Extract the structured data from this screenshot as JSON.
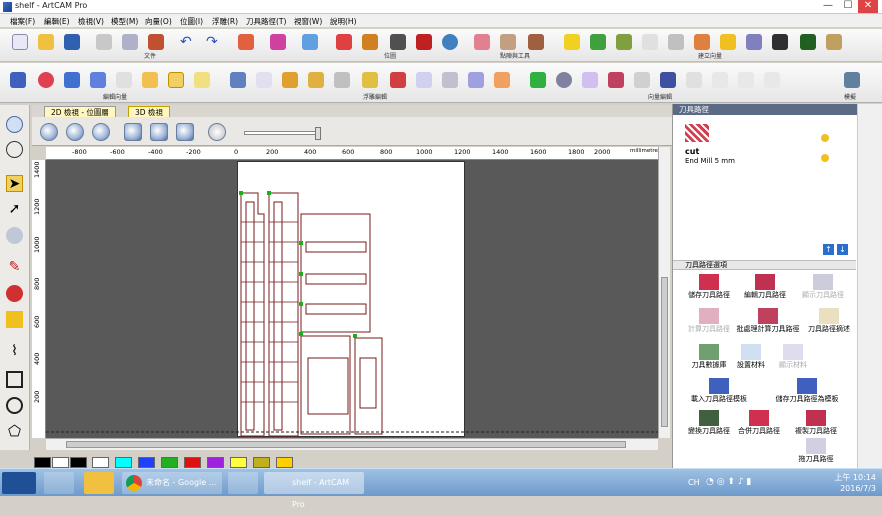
{
  "window": {
    "title": "shelf - ArtCAM Pro",
    "minimize": "—",
    "maximize": "☐",
    "close": "✕"
  },
  "menu": [
    "檔案(F)",
    "編輯(E)",
    "檢視(V)",
    "模型(M)",
    "向量(O)",
    "位圖(I)",
    "浮雕(R)",
    "刀具路徑(T)",
    "視窗(W)",
    "說明(H)"
  ],
  "toolbar_groups": {
    "file": "文件",
    "bitmap": "位圖",
    "relief_clipart": "點陣與工具",
    "vector_create": "建立向量",
    "vector_editing": "編輯向量",
    "relief_group": "浮雕編輯",
    "relief_layer": "浮雕",
    "vector_group": "向量編輯",
    "other": "模擬"
  },
  "view_tabs": [
    {
      "label": "2D 檢視 - 位圖層",
      "active": true
    },
    {
      "label": "3D 檢視",
      "active": false
    }
  ],
  "ruler": {
    "units": "millimetres",
    "h_labels": [
      "-800",
      "-600",
      "-400",
      "-200",
      "0",
      "200",
      "400",
      "600",
      "800",
      "1000",
      "1200",
      "1400",
      "1600",
      "1800",
      "2000",
      "2200"
    ],
    "v_labels": [
      "1400",
      "1200",
      "1000",
      "800",
      "600",
      "400",
      "200"
    ]
  },
  "right_panel": {
    "title": "刀具路徑",
    "toolpath": {
      "name": "cut",
      "tool": "End Mill 5 mm"
    },
    "options_title": "刀具路徑選項",
    "items": [
      [
        "儲存刀具路徑",
        "編輯刀具路徑",
        "顯示刀具路徑"
      ],
      [
        "計算刀具路徑",
        "批處理計算刀具路徑",
        "刀具路徑摘述"
      ],
      [
        "刀具數據庫",
        "設置材料",
        "顯示材料"
      ],
      [
        "載入刀具路徑模板",
        "儲存刀具路徑為模板",
        ""
      ],
      [
        "變換刀具路徑",
        "合併刀具路徑",
        "複製刀具路徑"
      ],
      [
        "",
        "",
        "拖刀具路徑"
      ]
    ]
  },
  "palette": [
    "#000000",
    "#ffffff",
    "#000000",
    "#ffffff",
    "#00ffff",
    "#2040ff",
    "#20b020",
    "#e01010",
    "#a020e0",
    "#ffff40",
    "#c0b020",
    "#ffd000"
  ],
  "taskbar": {
    "chrome_tab": "未命名 - Google ...",
    "artcam_tab": "shelf - ArtCAM Pro",
    "ime": "CH",
    "time": "上午 10:14",
    "date": "2016/7/3"
  },
  "colors": {
    "panel_header": "#5b6a85",
    "drawing": "#7a1b1b",
    "node": "#19b019"
  }
}
